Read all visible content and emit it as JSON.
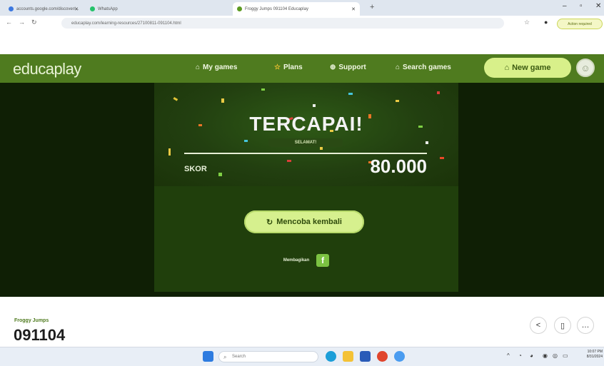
{
  "browser": {
    "tabs": [
      {
        "label": "accounts.google.com/discover/..."
      },
      {
        "label": "WhatsApp"
      },
      {
        "label": "Froggy Jumps 091104 Educaplay"
      }
    ],
    "url": "educaplay.com/learning-resources/27100811-091104.html",
    "profile_label": "Action required"
  },
  "site": {
    "logo": "educaplay",
    "menu": [
      "My games",
      "Plans",
      "Support",
      "Search games"
    ],
    "new_game": "New game"
  },
  "game": {
    "title": "TERCAPAI!",
    "subtitle": "SELAMAT!",
    "score_label": "SKOR",
    "score_value": "80.000",
    "retry": "Mencoba kembali",
    "share_label": "Membagikan"
  },
  "info": {
    "game_name": "Froggy Jumps",
    "game_code": "091104"
  },
  "taskbar": {
    "search_placeholder": "Search",
    "time": "10:07 PM",
    "date": "8/31/2024"
  },
  "colors": {
    "brand_green": "#4f7b1f",
    "accent_lime": "#d6f08e",
    "game_bg": "#0f1f05"
  }
}
